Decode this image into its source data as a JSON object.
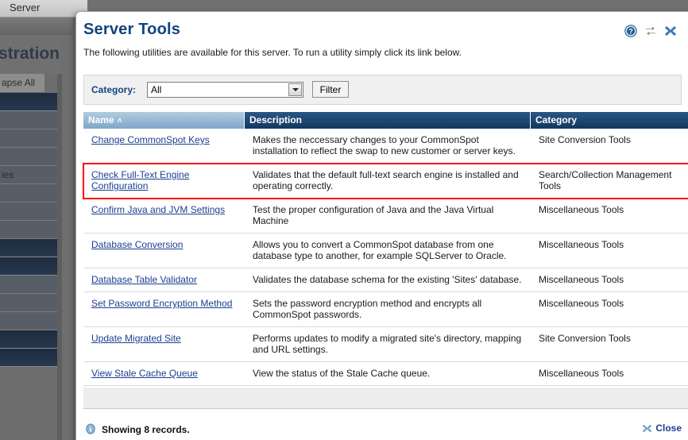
{
  "background": {
    "tab_label": "Server",
    "page_title": "stration",
    "collapse_all_label": "apse All",
    "nav_partial_label": "ies"
  },
  "dialog": {
    "title": "Server Tools",
    "subtitle": "The following utilities are available for this server. To run a utility simply click its link below.",
    "header_icons": [
      {
        "name": "help-icon",
        "glyph": "?"
      },
      {
        "name": "refresh-icon",
        "glyph": "⇄"
      },
      {
        "name": "close-icon",
        "glyph": "✖"
      }
    ]
  },
  "filter": {
    "label": "Category:",
    "selected": "All",
    "options": [
      "All"
    ],
    "button_label": "Filter"
  },
  "table": {
    "columns": [
      {
        "key": "name",
        "label": "Name",
        "sorted": true,
        "sort_caret": "˄"
      },
      {
        "key": "description",
        "label": "Description",
        "sorted": false,
        "sort_caret": ""
      },
      {
        "key": "category",
        "label": "Category",
        "sorted": false,
        "sort_caret": ""
      }
    ],
    "rows": [
      {
        "name": "Change CommonSpot Keys",
        "description": "Makes the neccessary changes to your CommonSpot installation to reflect the swap to new customer or server keys.",
        "category": "Site Conversion Tools",
        "highlighted": false
      },
      {
        "name": "Check Full-Text Engine Configuration",
        "description": "Validates that the default full-text search engine is installed and operating correctly.",
        "category": "Search/Collection Management Tools",
        "highlighted": true
      },
      {
        "name": "Confirm Java and JVM Settings",
        "description": "Test the proper configuration of Java and the Java Virtual Machine",
        "category": "Miscellaneous Tools",
        "highlighted": false
      },
      {
        "name": "Database Conversion",
        "description": "Allows you to convert a CommonSpot database from one database type to another, for example SQLServer to Oracle.",
        "category": "Miscellaneous Tools",
        "highlighted": false
      },
      {
        "name": "Database Table Validator",
        "description": "Validates the database schema for the existing 'Sites' database.",
        "category": "Miscellaneous Tools",
        "highlighted": false
      },
      {
        "name": "Set Password Encryption Method",
        "description": "Sets the password encryption method and encrypts all CommonSpot passwords.",
        "category": "Miscellaneous Tools",
        "highlighted": false
      },
      {
        "name": "Update Migrated Site",
        "description": "Performs updates to modify a migrated site's directory, mapping and URL settings.",
        "category": "Site Conversion Tools",
        "highlighted": false
      },
      {
        "name": "View Stale Cache Queue",
        "description": "View the status of the Stale Cache queue.",
        "category": "Miscellaneous Tools",
        "highlighted": false
      }
    ]
  },
  "footer": {
    "record_count_text": "Showing 8 records.",
    "close_label": "Close"
  },
  "colors": {
    "accent_blue": "#12447e",
    "link_blue": "#1a3f8f",
    "header_gradient_top": "#2e5b8e",
    "header_gradient_bottom": "#123a66",
    "sorted_col": "#7ea7c8",
    "highlight_red": "#ff0000",
    "panel_bg": "#f0f0f0"
  }
}
